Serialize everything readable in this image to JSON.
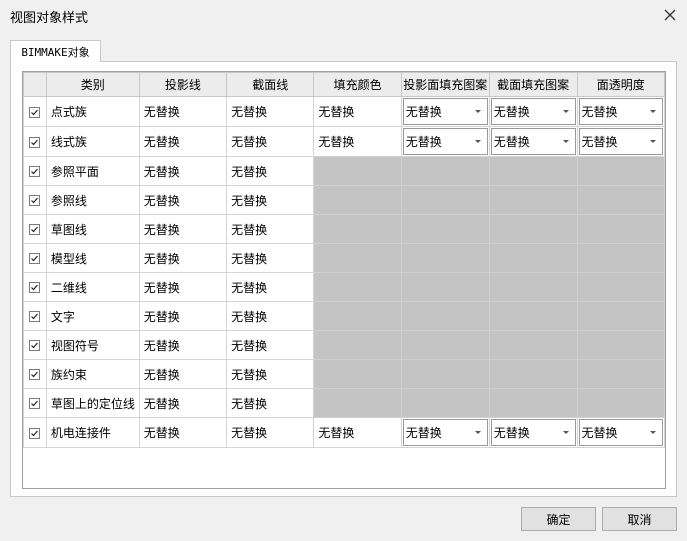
{
  "window": {
    "title": "视图对象样式"
  },
  "tab": {
    "label": "BIMMAKE对象"
  },
  "columns": [
    "类别",
    "投影线",
    "截面线",
    "填充颜色",
    "投影面填充图案",
    "截面填充图案",
    "面透明度"
  ],
  "rows": [
    {
      "checked": true,
      "name": "点式族",
      "proj_line": "无替换",
      "cut_line": "无替换",
      "fill_color": "无替换",
      "proj_pattern": "无替换",
      "cut_pattern": "无替换",
      "transparency": "无替换"
    },
    {
      "checked": true,
      "name": "线式族",
      "proj_line": "无替换",
      "cut_line": "无替换",
      "fill_color": "无替换",
      "proj_pattern": "无替换",
      "cut_pattern": "无替换",
      "transparency": "无替换"
    },
    {
      "checked": true,
      "name": "参照平面",
      "proj_line": "无替换",
      "cut_line": "无替换"
    },
    {
      "checked": true,
      "name": "参照线",
      "proj_line": "无替换",
      "cut_line": "无替换"
    },
    {
      "checked": true,
      "name": "草图线",
      "proj_line": "无替换",
      "cut_line": "无替换"
    },
    {
      "checked": true,
      "name": "模型线",
      "proj_line": "无替换",
      "cut_line": "无替换"
    },
    {
      "checked": true,
      "name": "二维线",
      "proj_line": "无替换",
      "cut_line": "无替换"
    },
    {
      "checked": true,
      "name": "文字",
      "proj_line": "无替换",
      "cut_line": "无替换"
    },
    {
      "checked": true,
      "name": "视图符号",
      "proj_line": "无替换",
      "cut_line": "无替换"
    },
    {
      "checked": true,
      "name": "族约束",
      "proj_line": "无替换",
      "cut_line": "无替换"
    },
    {
      "checked": true,
      "name": "草图上的定位线",
      "proj_line": "无替换",
      "cut_line": "无替换"
    },
    {
      "checked": true,
      "name": "机电连接件",
      "proj_line": "无替换",
      "cut_line": "无替换",
      "fill_color": "无替换",
      "proj_pattern": "无替换",
      "cut_pattern": "无替换",
      "transparency": "无替换"
    }
  ],
  "buttons": {
    "ok": "确定",
    "cancel": "取消"
  }
}
